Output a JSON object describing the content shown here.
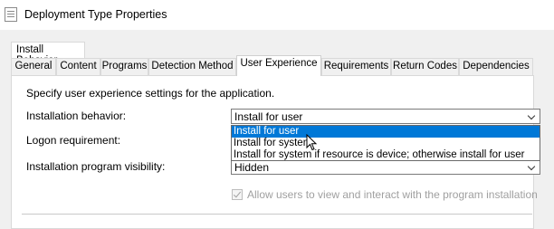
{
  "window": {
    "title": "Deployment Type Properties",
    "icon": "properties-icon"
  },
  "tabs_upper": [
    {
      "label": "Install Behavior"
    }
  ],
  "tabs": [
    {
      "label": "General"
    },
    {
      "label": "Content"
    },
    {
      "label": "Programs"
    },
    {
      "label": "Detection Method"
    },
    {
      "label": "User Experience",
      "active": true
    },
    {
      "label": "Requirements"
    },
    {
      "label": "Return Codes"
    },
    {
      "label": "Dependencies"
    }
  ],
  "panel": {
    "description": "Specify user experience settings for the application.",
    "installation_behavior": {
      "label": "Installation behavior:",
      "value": "Install for user",
      "options": [
        "Install for user",
        "Install for system",
        "Install for system if resource is device; otherwise install for user"
      ],
      "selected_option": "Install for user"
    },
    "logon_requirement": {
      "label": "Logon requirement:"
    },
    "program_visibility": {
      "label": "Installation program visibility:",
      "value": "Hidden"
    },
    "allow_interact": {
      "label": "Allow users to view and interact with the program installation",
      "checked": true,
      "enabled": false
    }
  },
  "colors": {
    "selection": "#0078d7",
    "disabled_text": "#a0a0a0"
  }
}
